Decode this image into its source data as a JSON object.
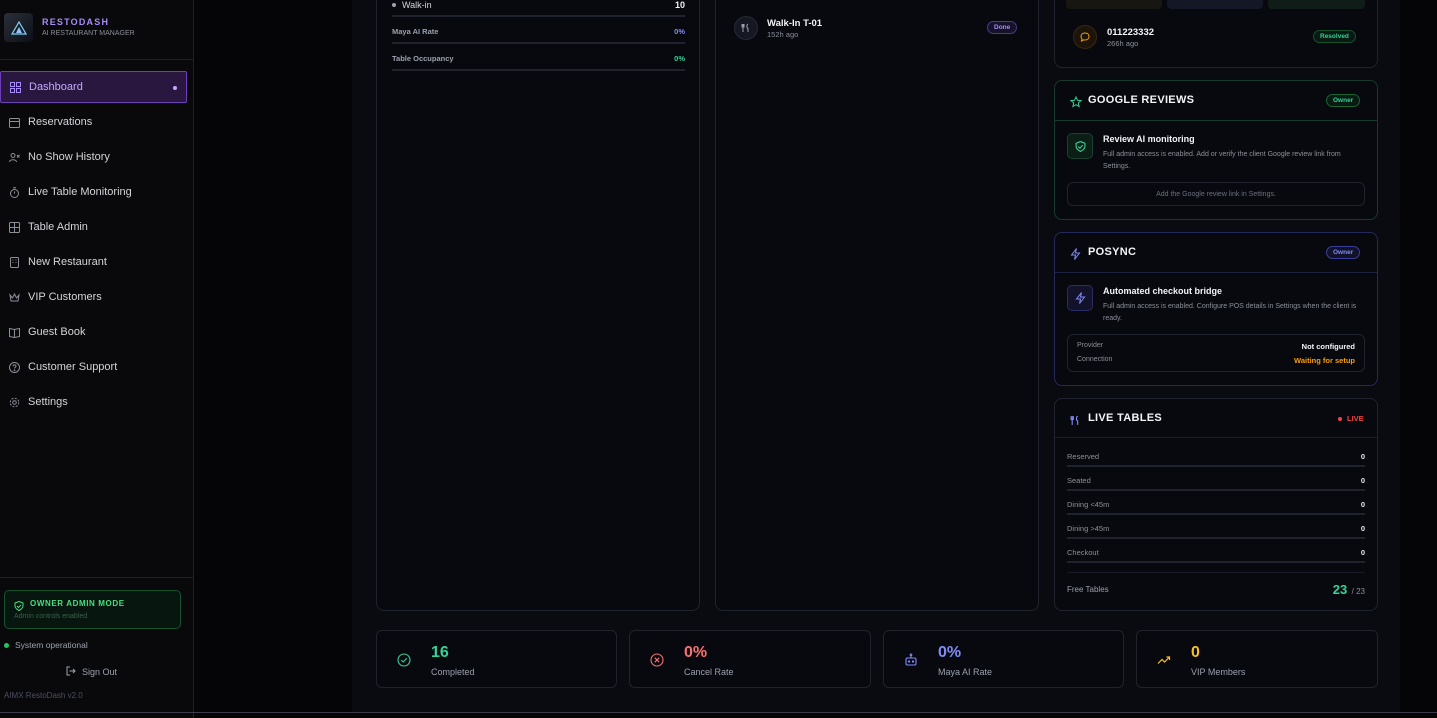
{
  "brand": {
    "title": "RESTODASH",
    "subtitle": "AI RESTAURANT MANAGER"
  },
  "sidebar": {
    "items": [
      {
        "label": "Dashboard",
        "icon": "grid-icon",
        "active": true
      },
      {
        "label": "Reservations",
        "icon": "calendar-icon"
      },
      {
        "label": "No Show History",
        "icon": "user-x-icon"
      },
      {
        "label": "Live Table Monitoring",
        "icon": "timer-icon"
      },
      {
        "label": "Table Admin",
        "icon": "table-icon"
      },
      {
        "label": "New Restaurant",
        "icon": "building-icon"
      },
      {
        "label": "VIP Customers",
        "icon": "crown-icon"
      },
      {
        "label": "Guest Book",
        "icon": "book-icon"
      },
      {
        "label": "Customer Support",
        "icon": "help-circle-icon"
      },
      {
        "label": "Settings",
        "icon": "gear-icon"
      }
    ],
    "admin_mode": {
      "title": "OWNER ADMIN MODE",
      "subtitle": "Admin controls enabled"
    },
    "status": "System operational",
    "sign_out": "Sign Out",
    "version": "AIMX RestoDash v2.0"
  },
  "metrics_card": {
    "walkin_label": "Walk-in",
    "walkin_value": "10",
    "maya_rate_label": "Maya AI Rate",
    "maya_rate_value": "0%",
    "occupancy_label": "Table Occupancy",
    "occupancy_value": "0%"
  },
  "activity_card": {
    "item_title": "Walk-In T-01",
    "item_time": "152h ago",
    "item_badge": "Done"
  },
  "support_card": {
    "ticket_number": "011223332",
    "ticket_time": "266h ago",
    "ticket_badge": "Resolved"
  },
  "google_reviews": {
    "title": "GOOGLE REVIEWS",
    "badge": "Owner",
    "heading": "Review AI monitoring",
    "description": "Full admin access is enabled. Add or verify the client Google review link from Settings.",
    "action": "Add the Google review link in Settings."
  },
  "posync": {
    "title": "POSYNC",
    "badge": "Owner",
    "heading": "Automated checkout bridge",
    "description": "Full admin access is enabled. Configure POS details in Settings when the client is ready.",
    "provider_label": "Provider",
    "provider_value": "Not configured",
    "connection_label": "Connection",
    "connection_value": "Waiting for setup"
  },
  "live_tables": {
    "title": "LIVE TABLES",
    "live_label": "LIVE",
    "rows": [
      {
        "label": "Reserved",
        "value": "0"
      },
      {
        "label": "Seated",
        "value": "0"
      },
      {
        "label": "Dining <45m",
        "value": "0"
      },
      {
        "label": "Dining >45m",
        "value": "0"
      },
      {
        "label": "Checkout",
        "value": "0"
      }
    ],
    "free_label": "Free Tables",
    "free_value": "23",
    "free_total": "/ 23"
  },
  "stats": [
    {
      "value": "16",
      "label": "Completed",
      "color": "#34d399",
      "icon": "check-circle-icon"
    },
    {
      "value": "0%",
      "label": "Cancel Rate",
      "color": "#f87171",
      "icon": "x-circle-icon"
    },
    {
      "value": "0%",
      "label": "Maya AI Rate",
      "color": "#818cf8",
      "icon": "bot-icon"
    },
    {
      "value": "0",
      "label": "VIP Members",
      "color": "#fbbf24",
      "icon": "trending-up-icon"
    }
  ]
}
